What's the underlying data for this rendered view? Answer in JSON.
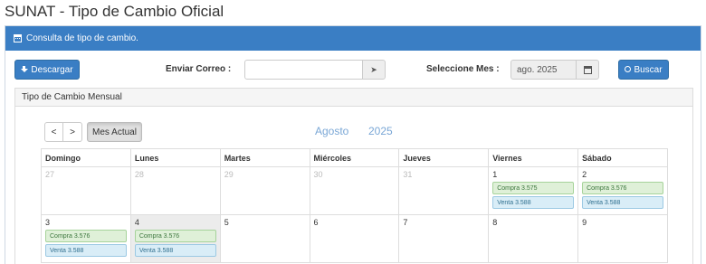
{
  "page_title": "SUNAT - Tipo de Cambio Oficial",
  "panel": {
    "title": "Consulta de tipo de cambio.",
    "download_label": "Descargar",
    "email_label": "Enviar Correo :",
    "email_value": "",
    "email_placeholder": "",
    "month_label": "Seleccione Mes :",
    "month_value": "ago. 2025",
    "search_label": "Buscar"
  },
  "calendar": {
    "heading": "Tipo de Cambio Mensual",
    "prev": "<",
    "next": ">",
    "today_label": "Mes Actual",
    "month": "Agosto",
    "year": "2025",
    "weekdays": [
      "Domingo",
      "Lunes",
      "Martes",
      "Miércoles",
      "Jueves",
      "Viernes",
      "Sábado"
    ],
    "weeks": [
      [
        {
          "day": "27",
          "other": true
        },
        {
          "day": "28",
          "other": true
        },
        {
          "day": "29",
          "other": true
        },
        {
          "day": "30",
          "other": true
        },
        {
          "day": "31",
          "other": true
        },
        {
          "day": "1",
          "compra": "Compra 3.575",
          "venta": "Venta 3.588"
        },
        {
          "day": "2",
          "compra": "Compra 3.576",
          "venta": "Venta 3.588"
        }
      ],
      [
        {
          "day": "3",
          "compra": "Compra 3.576",
          "venta": "Venta 3.588"
        },
        {
          "day": "4",
          "today": true,
          "compra": "Compra 3.576",
          "venta": "Venta 3.588"
        },
        {
          "day": "5"
        },
        {
          "day": "6"
        },
        {
          "day": "7"
        },
        {
          "day": "8"
        },
        {
          "day": "9"
        }
      ]
    ]
  }
}
